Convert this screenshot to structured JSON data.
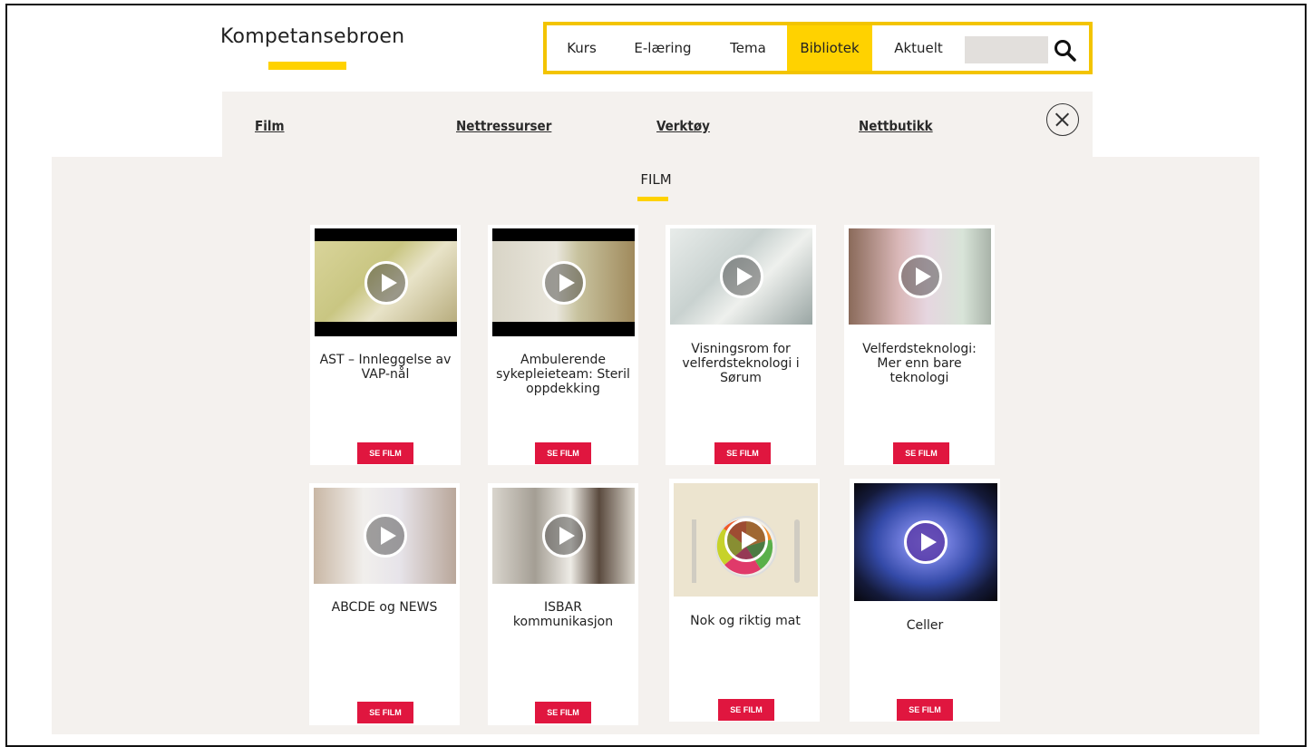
{
  "header": {
    "logo_text": "Kompetansebroen",
    "nav": [
      {
        "label": "Kurs",
        "active": false
      },
      {
        "label": "E-læring",
        "active": false
      },
      {
        "label": "Tema",
        "active": false
      },
      {
        "label": "Bibliotek",
        "active": true
      },
      {
        "label": "Aktuelt",
        "active": false
      }
    ],
    "search": {
      "placeholder": "",
      "icon": "search-icon"
    }
  },
  "subnav": {
    "links": [
      "Film",
      "Nettressurser",
      "Verktøy",
      "Nettbutikk"
    ],
    "close_icon": "close-icon"
  },
  "section": {
    "title": "FILM"
  },
  "cards": [
    {
      "title": "AST – Innleggelse av VAP-nål",
      "button": "SE FILM"
    },
    {
      "title": "Ambulerende sykepleieteam: Steril oppdekking",
      "button": "SE FILM"
    },
    {
      "title": "Visningsrom for velferdsteknologi i Sørum",
      "button": "SE FILM"
    },
    {
      "title": "Velferdsteknologi: Mer enn bare teknologi",
      "button": "SE FILM"
    },
    {
      "title": "ABCDE og NEWS",
      "button": "SE FILM"
    },
    {
      "title": "ISBAR kommunikasjon",
      "button": "SE FILM"
    },
    {
      "title": "Nok og riktig mat",
      "button": "SE FILM"
    },
    {
      "title": "Celler",
      "button": "SE FILM"
    }
  ],
  "colors": {
    "accent": "#ffd200",
    "button": "#e0163f",
    "panel": "#f4f1ee"
  }
}
